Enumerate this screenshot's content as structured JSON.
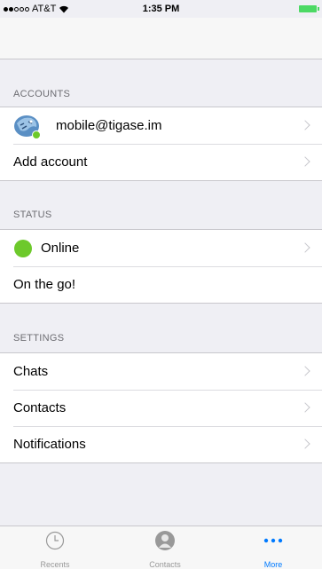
{
  "status_bar": {
    "carrier": "AT&T",
    "time": "1:35 PM"
  },
  "sections": {
    "accounts": {
      "header": "ACCOUNTS",
      "items": [
        {
          "label": "mobile@tigase.im"
        },
        {
          "label": "Add account"
        }
      ]
    },
    "status": {
      "header": "STATUS",
      "items": [
        {
          "label": "Online"
        },
        {
          "label": "On the go!"
        }
      ]
    },
    "settings": {
      "header": "SETTINGS",
      "items": [
        {
          "label": "Chats"
        },
        {
          "label": "Contacts"
        },
        {
          "label": "Notifications"
        }
      ]
    }
  },
  "tabbar": {
    "items": [
      {
        "label": "Recents",
        "icon": "clock-icon"
      },
      {
        "label": "Contacts",
        "icon": "person-icon"
      },
      {
        "label": "More",
        "icon": "ellipsis-icon",
        "active": true
      }
    ]
  },
  "colors": {
    "accent": "#007aff",
    "online": "#6dc92b",
    "background": "#efeff4"
  }
}
